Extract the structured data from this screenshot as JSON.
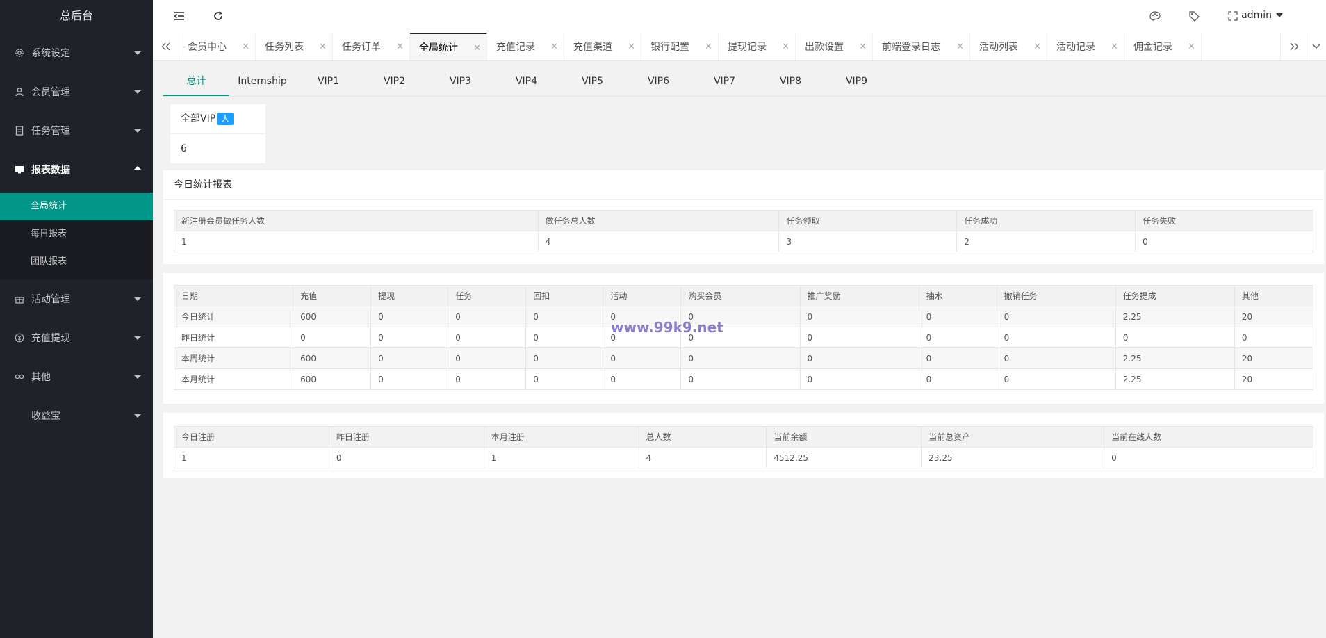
{
  "sidebar": {
    "brand": "总后台",
    "menu": [
      {
        "label": "系统设定",
        "icon": "gear-icon"
      },
      {
        "label": "会员管理",
        "icon": "user-icon"
      },
      {
        "label": "任务管理",
        "icon": "document-icon"
      },
      {
        "label": "报表数据",
        "icon": "monitor-icon"
      },
      {
        "label": "活动管理",
        "icon": "gift-icon"
      },
      {
        "label": "充值提现",
        "icon": "yen-icon"
      },
      {
        "label": "其他",
        "icon": "link-icon"
      },
      {
        "label": "收益宝",
        "icon": ""
      }
    ],
    "submenu": [
      "全局统计",
      "每日报表",
      "团队报表"
    ]
  },
  "topbar": {
    "user": "admin"
  },
  "tabs": [
    "会员中心",
    "任务列表",
    "任务订单",
    "全局统计",
    "充值记录",
    "充值渠道",
    "银行配置",
    "提现记录",
    "出款设置",
    "前端登录日志",
    "活动列表",
    "活动记录",
    "佣金记录"
  ],
  "vip_tabs": [
    "总计",
    "Internship",
    "VIP1",
    "VIP2",
    "VIP3",
    "VIP4",
    "VIP5",
    "VIP6",
    "VIP7",
    "VIP8",
    "VIP9"
  ],
  "vip_card": {
    "label": "全部VIP",
    "badge": "人",
    "value": "6"
  },
  "today_report": {
    "title": "今日统计报表",
    "headers": [
      "新注册会员做任务人数",
      "做任务总人数",
      "任务领取",
      "任务成功",
      "任务失败"
    ],
    "row": [
      "1",
      "4",
      "3",
      "2",
      "0"
    ]
  },
  "stats_table": {
    "headers": [
      "日期",
      "充值",
      "提现",
      "任务",
      "回扣",
      "活动",
      "购买会员",
      "推广奖励",
      "抽水",
      "撤销任务",
      "任务提成",
      "其他"
    ],
    "rows": [
      [
        "今日统计",
        "600",
        "0",
        "0",
        "0",
        "0",
        "0",
        "0",
        "0",
        "0",
        "2.25",
        "20"
      ],
      [
        "昨日统计",
        "0",
        "0",
        "0",
        "0",
        "0",
        "0",
        "0",
        "0",
        "0",
        "0",
        "0"
      ],
      [
        "本周统计",
        "600",
        "0",
        "0",
        "0",
        "0",
        "0",
        "0",
        "0",
        "0",
        "2.25",
        "20"
      ],
      [
        "本月统计",
        "600",
        "0",
        "0",
        "0",
        "0",
        "0",
        "0",
        "0",
        "0",
        "2.25",
        "20"
      ]
    ]
  },
  "register_table": {
    "headers": [
      "今日注册",
      "昨日注册",
      "本月注册",
      "总人数",
      "当前余额",
      "当前总资产",
      "当前在线人数"
    ],
    "row": [
      "1",
      "0",
      "1",
      "4",
      "4512.25",
      "23.25",
      "0"
    ]
  },
  "watermark": "www.99k9.net"
}
